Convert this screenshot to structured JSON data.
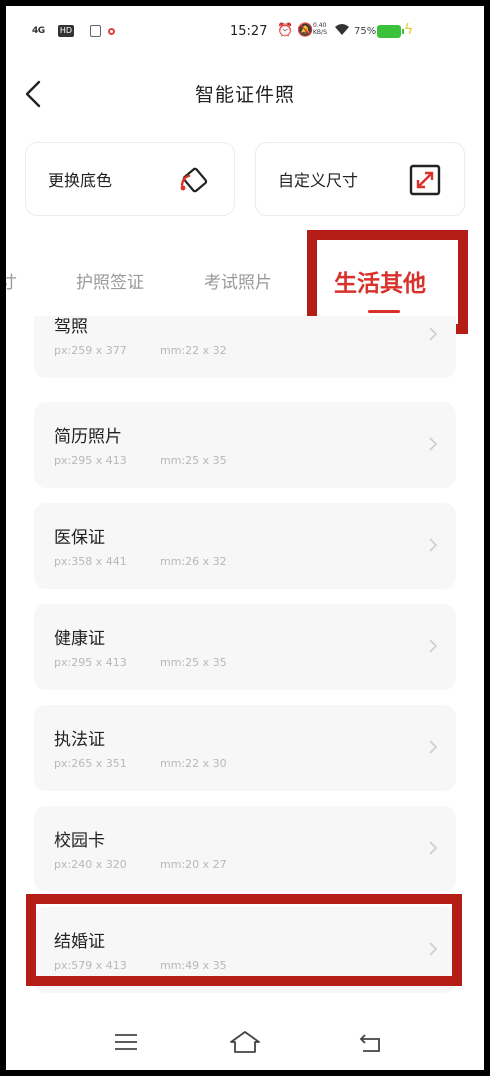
{
  "status_bar": {
    "signal": "4G",
    "hd_badge": "HD",
    "time": "15:27",
    "net_speed_value": "0.40",
    "net_speed_unit": "KB/S",
    "battery": "75%"
  },
  "header": {
    "title": "智能证件照"
  },
  "tools": {
    "change_bg_label": "更换底色",
    "custom_size_label": "自定义尺寸"
  },
  "tabs": [
    {
      "label": "寸"
    },
    {
      "label": "护照签证"
    },
    {
      "label": "考试照片"
    },
    {
      "label": "生活其他"
    }
  ],
  "items": [
    {
      "name": "驾照",
      "px": "px:259 x 377",
      "mm": "mm:22 x 32"
    },
    {
      "name": "简历照片",
      "px": "px:295 x 413",
      "mm": "mm:25 x 35"
    },
    {
      "name": "医保证",
      "px": "px:358 x 441",
      "mm": "mm:26 x 32"
    },
    {
      "name": "健康证",
      "px": "px:295 x 413",
      "mm": "mm:25 x 35"
    },
    {
      "name": "执法证",
      "px": "px:265 x 351",
      "mm": "mm:22 x 30"
    },
    {
      "name": "校园卡",
      "px": "px:240 x 320",
      "mm": "mm:20 x 27"
    },
    {
      "name": "结婚证",
      "px": "px:579 x 413",
      "mm": "mm:49 x 35"
    }
  ],
  "colors": {
    "accent": "#d8322b",
    "highlight_box": "#b51e17",
    "battery": "#3cc13b"
  },
  "icons": {
    "back": "chevron-left-icon",
    "bucket": "paint-bucket-icon",
    "resize": "resize-icon",
    "chevron": "chevron-right-icon",
    "menu": "menu-icon",
    "home": "home-icon",
    "return": "return-icon"
  }
}
